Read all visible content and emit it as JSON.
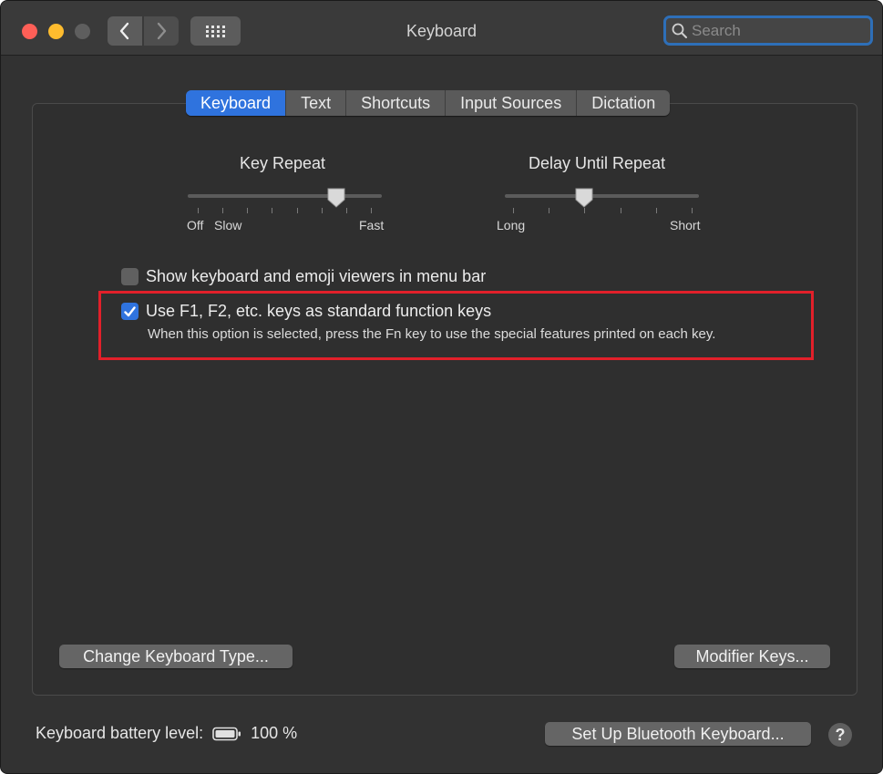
{
  "window": {
    "title": "Keyboard"
  },
  "search": {
    "placeholder": "Search",
    "value": ""
  },
  "tabs": [
    {
      "label": "Keyboard",
      "active": true
    },
    {
      "label": "Text",
      "active": false
    },
    {
      "label": "Shortcuts",
      "active": false
    },
    {
      "label": "Input Sources",
      "active": false
    },
    {
      "label": "Dictation",
      "active": false
    }
  ],
  "key_repeat": {
    "title": "Key Repeat",
    "min_label": "Off",
    "slow_label": "Slow",
    "max_label": "Fast",
    "tick_count": 8,
    "value_fraction": 0.8
  },
  "delay_until_repeat": {
    "title": "Delay Until Repeat",
    "min_label": "Long",
    "max_label": "Short",
    "tick_count": 6,
    "value_fraction": 0.4
  },
  "options": {
    "show_viewers": {
      "label": "Show keyboard and emoji viewers in menu bar",
      "checked": false
    },
    "fn_keys": {
      "label": "Use F1, F2, etc. keys as standard function keys",
      "description": "When this option is selected, press the Fn key to use the special features printed on each key.",
      "checked": true
    }
  },
  "buttons": {
    "change_type": "Change Keyboard Type...",
    "modifier_keys": "Modifier Keys...",
    "bluetooth": "Set Up Bluetooth Keyboard...",
    "help": "?"
  },
  "battery": {
    "label": "Keyboard battery level:",
    "value": "100 %"
  },
  "colors": {
    "accent": "#2f73de",
    "highlight": "#e2202a",
    "window_bg": "#323232"
  }
}
